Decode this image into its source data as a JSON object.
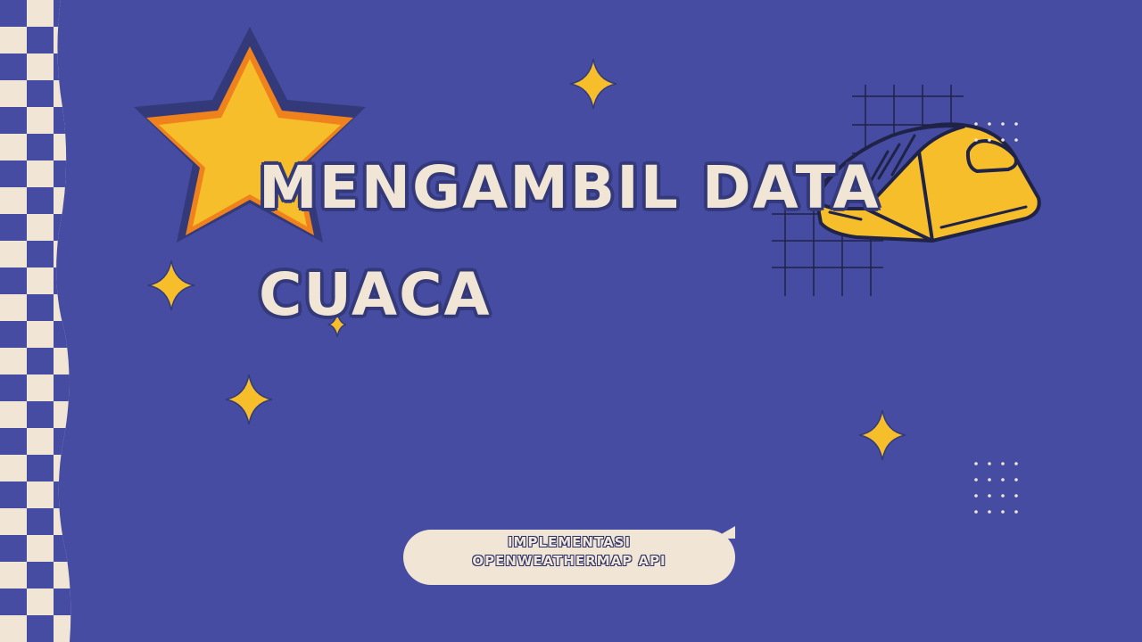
{
  "slide": {
    "title_line1": "MENGAMBIL DATA",
    "title_line2": "CUACA",
    "subtitle_line1": "IMPLEMENTASI",
    "subtitle_line2": "OPENWEATHERMAP API"
  },
  "colors": {
    "background": "#464ca1",
    "cream": "#f1e6d6",
    "yellow": "#f6be2a",
    "orange": "#f0821e",
    "outline": "#343a79",
    "dark_navy": "#1f2347"
  },
  "icons": [
    "star-icon",
    "sparkle-icon",
    "mouse-icon",
    "grid-icon",
    "dots-icon",
    "checker-pattern"
  ]
}
